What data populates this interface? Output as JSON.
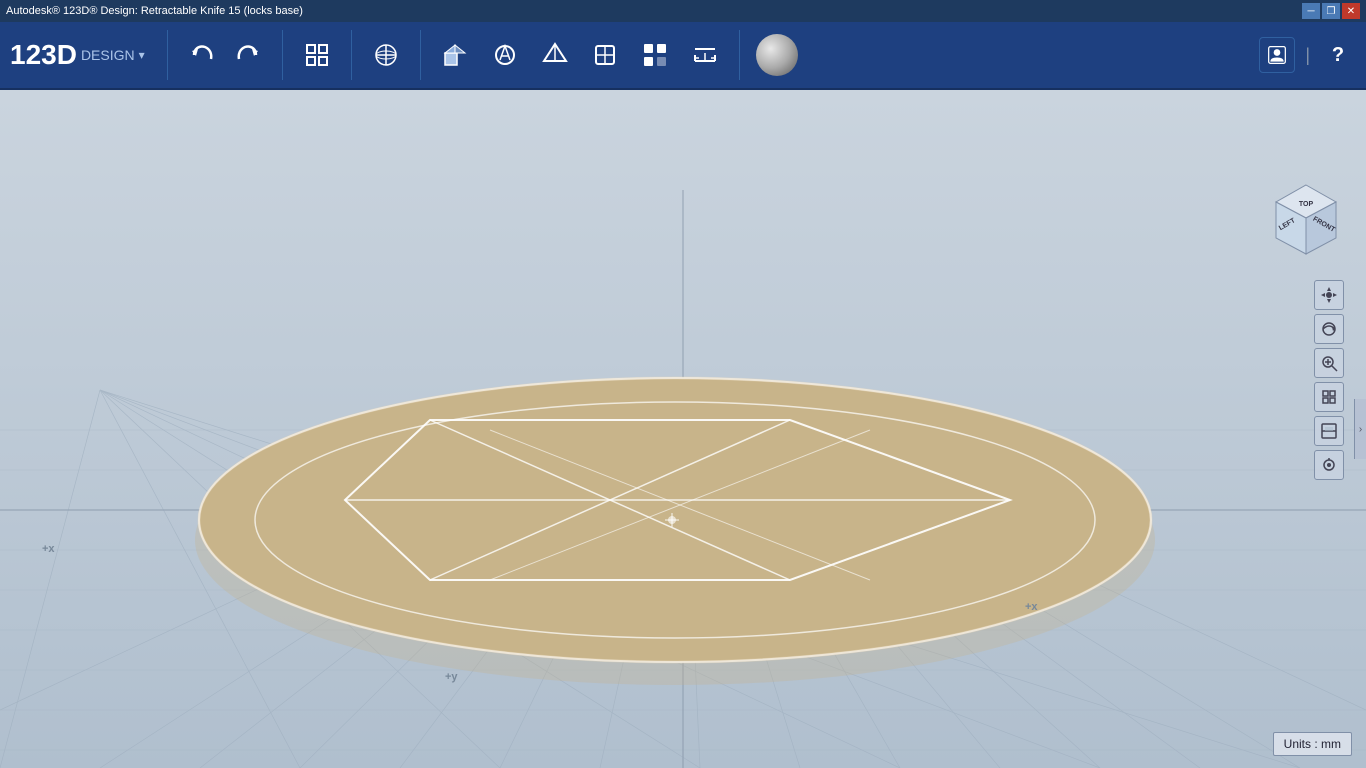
{
  "window": {
    "title": "Autodesk® 123D® Design: Retractable Knife 15 (locks base)"
  },
  "titlebar": {
    "title": "Autodesk® 123D® Design: Retractable Knife 15 (locks base)",
    "minimize_label": "─",
    "restore_label": "❐",
    "close_label": "✕"
  },
  "logo": {
    "number": "123D",
    "text": "DESIGN",
    "dropdown_arrow": "▾"
  },
  "toolbar": {
    "undo_label": "↩",
    "redo_label": "↪",
    "fit_label": "⊞",
    "transform_label": "⊕",
    "primitives_label": "◻",
    "sketch_label": "✏",
    "construct_label": "⚙",
    "modify_label": "◈",
    "pattern_label": "⊞",
    "measure_label": "◫",
    "group_label": "⊡"
  },
  "units": {
    "label": "Units : mm"
  },
  "nav_cube": {
    "left": "LEFT",
    "front": "FRONT",
    "top": "TOP"
  },
  "view_controls": {
    "pan": "+",
    "orbit": "↻",
    "zoom_in": "🔍",
    "fit": "⊞",
    "section": "◫",
    "camera": "👁"
  },
  "axis": {
    "x_label": "+x",
    "y_label": "+y"
  },
  "colors": {
    "toolbar_bg": "#1e4080",
    "viewport_bg": "#b8c4d0",
    "object_fill": "#c8b48a",
    "object_stroke": "#ffffff",
    "grid_line": "#9aaabb"
  }
}
